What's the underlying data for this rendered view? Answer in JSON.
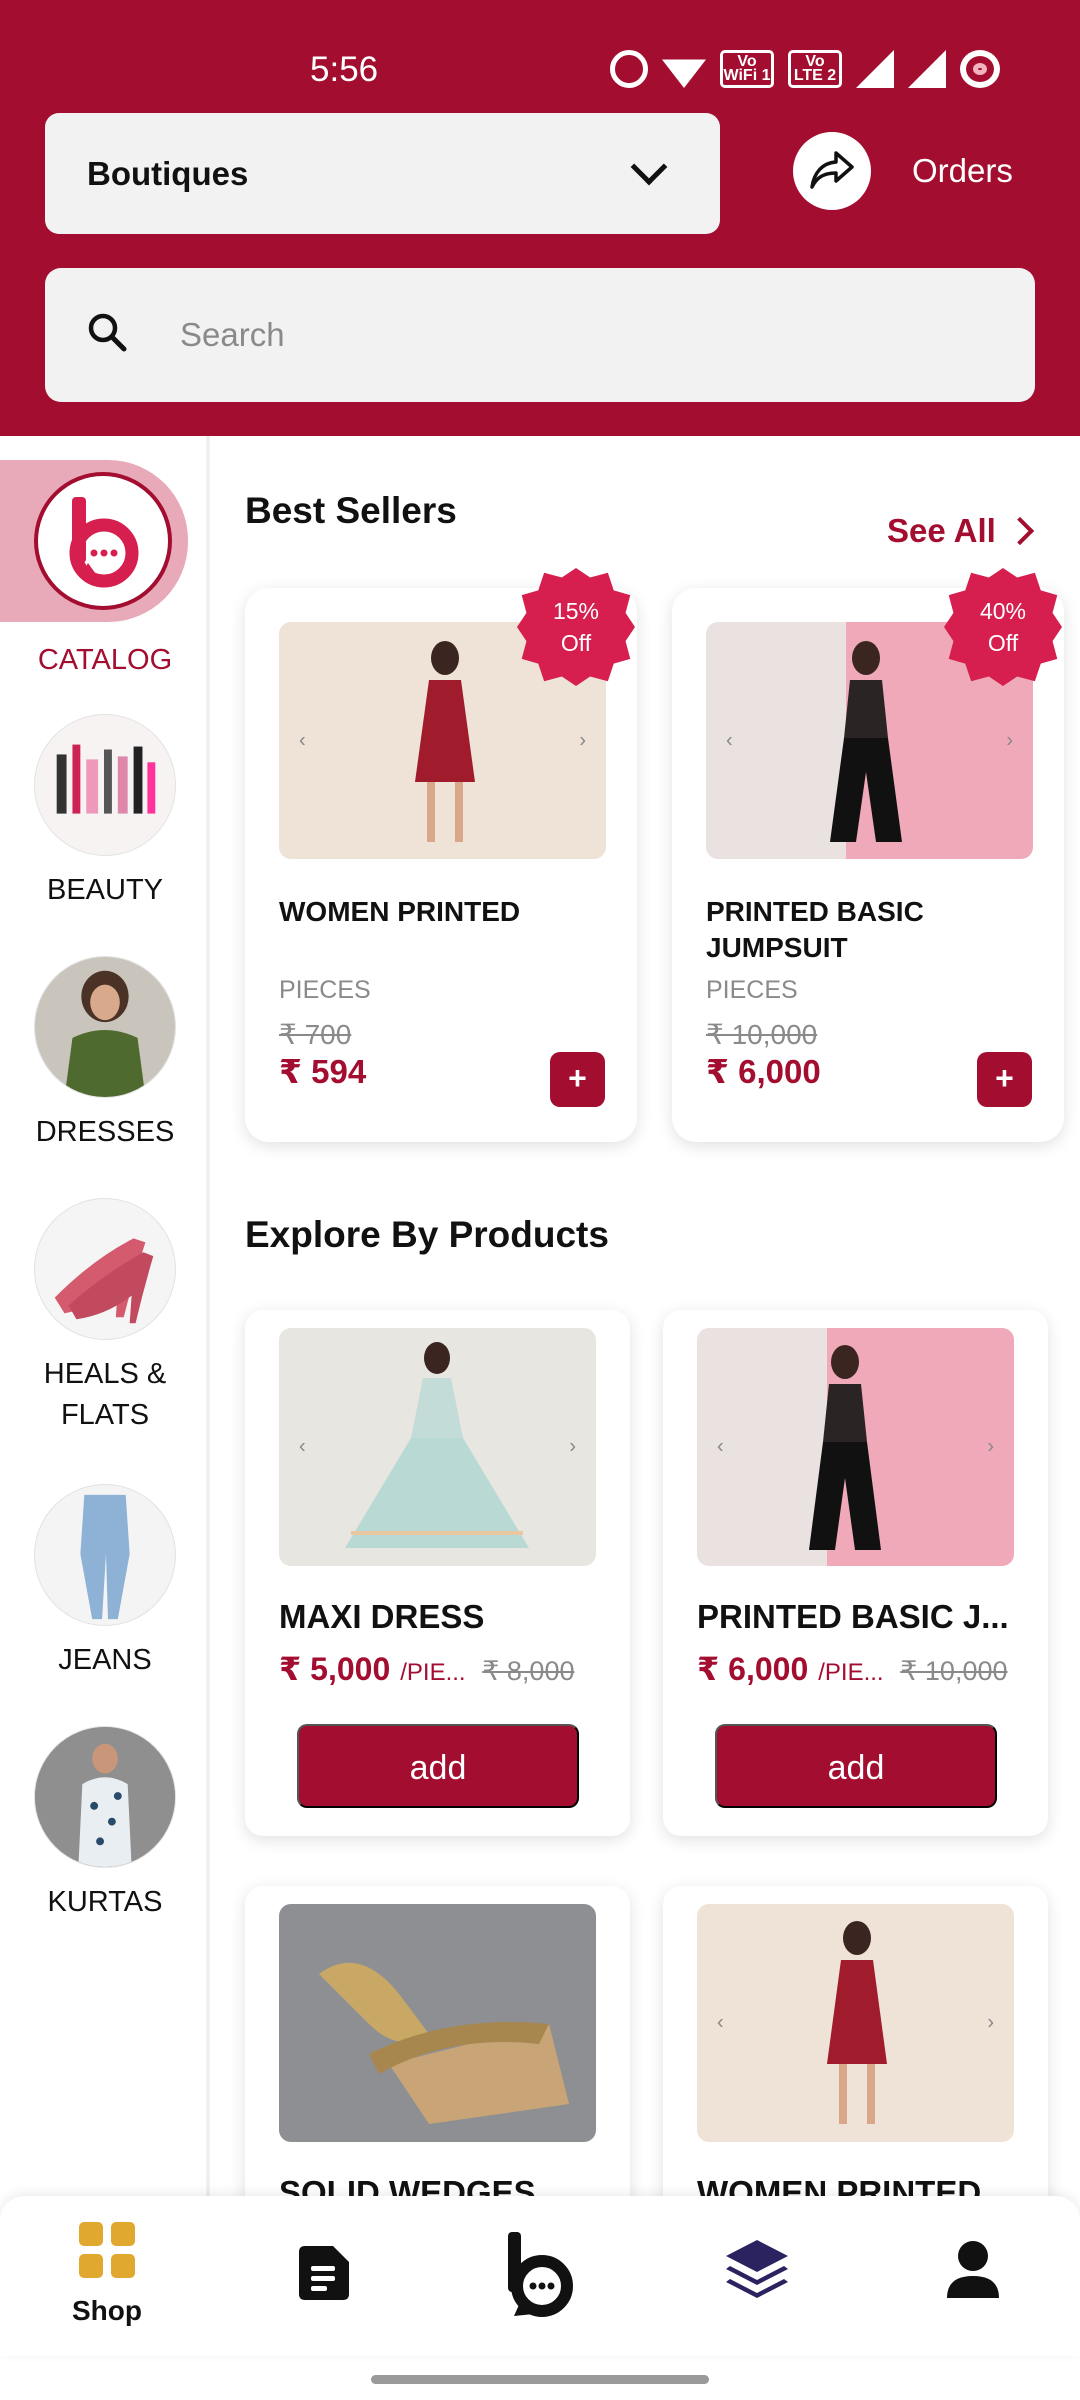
{
  "status": {
    "time": "5:56",
    "wifi_badge": "Vo WiFi 1",
    "lte_badge": "Vo LTE 2"
  },
  "header": {
    "store_selector": "Boutiques",
    "orders_label": "Orders"
  },
  "search": {
    "placeholder": "Search"
  },
  "sidebar": {
    "items": [
      {
        "label": "CATALOG"
      },
      {
        "label": "BEAUTY"
      },
      {
        "label": "DRESSES"
      },
      {
        "label": "HEALS & FLATS"
      },
      {
        "label": "JEANS"
      },
      {
        "label": "KURTAS"
      }
    ]
  },
  "best_sellers": {
    "title": "Best Sellers",
    "see_all": "See All",
    "items": [
      {
        "name": "WOMEN PRINTED",
        "unit": "PIECES",
        "old_price": "₹ 700",
        "price": "₹ 594",
        "badge_pct": "15%",
        "badge_off": "Off"
      },
      {
        "name": "PRINTED BASIC JUMPSUIT",
        "unit": "PIECES",
        "old_price": "₹ 10,000",
        "price": "₹ 6,000",
        "badge_pct": "40%",
        "badge_off": "Off"
      }
    ]
  },
  "explore": {
    "title": "Explore By Products",
    "items": [
      {
        "name": "MAXI DRESS",
        "price": "₹ 5,000",
        "unit": "/PIE...",
        "old_price": "₹ 8,000",
        "add_label": "add"
      },
      {
        "name": "PRINTED BASIC J...",
        "price": "₹ 6,000",
        "unit": "/PIE...",
        "old_price": "₹ 10,000",
        "add_label": "add"
      },
      {
        "name": "SOLID WEDGES"
      },
      {
        "name": "WOMEN PRINTED"
      }
    ]
  },
  "nav": {
    "shop_label": "Shop"
  },
  "colors": {
    "brand": "#a30d2f",
    "badge": "#d61f4e",
    "active_tab_bg": "#e8a9b8",
    "shop_icon": "#e0a82e"
  }
}
